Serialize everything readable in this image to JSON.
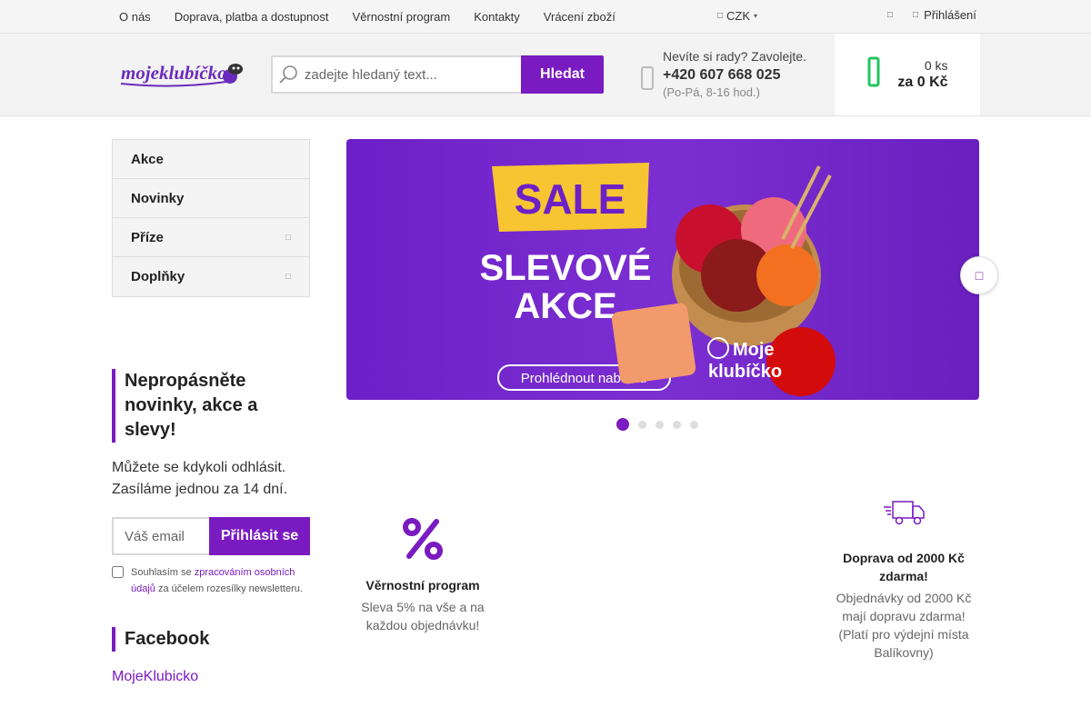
{
  "topnav": {
    "links": [
      "O nás",
      "Doprava, platba a dostupnost",
      "Věrnostní program",
      "Kontakty",
      "Vrácení zboží"
    ],
    "currency": "CZK",
    "login": "Přihlášení"
  },
  "header": {
    "logo_text": "mojeklubíčko",
    "search_placeholder": "zadejte hledaný text...",
    "search_button": "Hledat",
    "help_question": "Nevíte si rady? Zavolejte.",
    "phone": "+420 607 668 025",
    "hours": "(Po-Pá, 8-16 hod.)",
    "cart_count": "0 ks",
    "cart_total": "za 0 Kč"
  },
  "sidebar": {
    "items": [
      {
        "label": "Akce",
        "has_submenu": false
      },
      {
        "label": "Novinky",
        "has_submenu": false
      },
      {
        "label": "Příze",
        "has_submenu": true
      },
      {
        "label": "Doplňky",
        "has_submenu": true
      }
    ]
  },
  "banner": {
    "badge": "SALE",
    "line1": "SLEVOVÉ",
    "line2": "AKCE",
    "cta": "Prohlédnout nabídku",
    "brand_line1": "Moje",
    "brand_line2": "klubíčko",
    "slide_count": 5,
    "active_slide": 1
  },
  "newsletter": {
    "title": "Nepropásněte novinky, akce a slevy!",
    "text": "Můžete se kdykoli odhlásit. Zasíláme jednou za 14 dní.",
    "placeholder": "Váš email",
    "button": "Přihlásit se",
    "consent_pre": "Souhlasím se ",
    "consent_link": "zpracováním osobních údajů",
    "consent_post": " za účelem rozesílky newsletteru."
  },
  "facebook": {
    "title": "Facebook",
    "link": "MojeKlubicko"
  },
  "benefits": [
    {
      "icon": "percent-icon",
      "title": "Věrnostní program",
      "desc": "Sleva 5% na vše a na každou objednávku!"
    },
    {
      "icon": "delivery-truck-icon",
      "title": "Doprava od 2000 Kč zdarma!",
      "desc": "Objednávky od 2000 Kč mají dopravu zdarma! (Platí pro výdejní místa Balíkovny)"
    }
  ],
  "colors": {
    "accent": "#7a1bc1",
    "banner_bg": "#7b2fd1",
    "sale_badge": "#f7c531",
    "cart_icon": "#22c55e"
  }
}
